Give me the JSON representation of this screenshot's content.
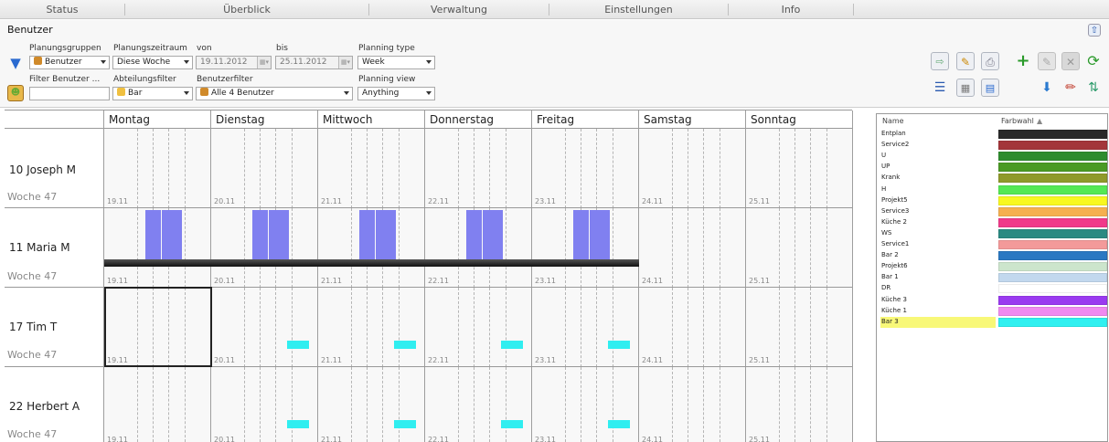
{
  "menu": [
    "Status",
    "Überblick",
    "Verwaltung",
    "Einstellungen",
    "Info"
  ],
  "section_title": "Benutzer",
  "filters": {
    "planungsgruppen_label": "Planungsgruppen",
    "planungsgruppen_value": "Benutzer",
    "planungszeitraum_label": "Planungszeitraum",
    "planungszeitraum_value": "Diese Woche",
    "von_label": "von",
    "von_value": "19.11.2012",
    "bis_label": "bis",
    "bis_value": "25.11.2012",
    "planning_type_label": "Planning type",
    "planning_type_value": "Week",
    "filter_benutzer_label": "Filter Benutzer ...",
    "filter_benutzer_value": "",
    "abteilungsfilter_label": "Abteilungsfilter",
    "abteilungsfilter_value": "Bar",
    "benutzerfilter_label": "Benutzerfilter",
    "benutzerfilter_value": "Alle 4 Benutzer",
    "planning_view_label": "Planning view",
    "planning_view_value": "Anything"
  },
  "days": [
    "Montag",
    "Dienstag",
    "Mittwoch",
    "Donnerstag",
    "Freitag",
    "Samstag",
    "Sonntag"
  ],
  "dates": [
    "19.11",
    "20.11",
    "21.11",
    "22.11",
    "23.11",
    "24.11",
    "25.11"
  ],
  "rows": [
    {
      "name": "10 Joseph M",
      "week": "Woche 47"
    },
    {
      "name": "11 Maria M",
      "week": "Woche 47"
    },
    {
      "name": "17 Tim T",
      "week": "Woche 47"
    },
    {
      "name": "22 Herbert A",
      "week": "Woche 47"
    }
  ],
  "legend": {
    "header_name": "Name",
    "header_color": "Farbwahl",
    "selected": "Bar 3",
    "items": [
      {
        "name": "Entplan",
        "color": "#2a2a2a"
      },
      {
        "name": "Service2",
        "color": "#a3363a"
      },
      {
        "name": "U",
        "color": "#2e8c2e"
      },
      {
        "name": "UP",
        "color": "#4a9a24"
      },
      {
        "name": "Krank",
        "color": "#8f9a2a"
      },
      {
        "name": "H",
        "color": "#54e854"
      },
      {
        "name": "Projekt5",
        "color": "#f8f820"
      },
      {
        "name": "Service3",
        "color": "#f5b050"
      },
      {
        "name": "Küche 2",
        "color": "#f03a8a"
      },
      {
        "name": "WS",
        "color": "#2a8a82"
      },
      {
        "name": "Service1",
        "color": "#f39a9a"
      },
      {
        "name": "Bar 2",
        "color": "#2a78c2"
      },
      {
        "name": "Projekt6",
        "color": "#cce5cc"
      },
      {
        "name": "Bar 1",
        "color": "#c2d8ee"
      },
      {
        "name": "DR",
        "color": "#ffffff"
      },
      {
        "name": "Küche 3",
        "color": "#9a3af0"
      },
      {
        "name": "Küche 1",
        "color": "#f08af0"
      },
      {
        "name": "Bar 3",
        "color": "#30f0f0"
      }
    ]
  },
  "colors": {
    "shift_blue": "#8080f0",
    "shift_cyan": "#30eef0",
    "selected_row": "#f8f878"
  },
  "toolbar_icons": [
    "import-icon",
    "edit-document-icon",
    "print-icon",
    "add-icon",
    "edit-icon",
    "delete-icon",
    "refresh-icon",
    "list-icon",
    "table-icon",
    "form-icon",
    "download-icon",
    "pencil-icon",
    "swap-icon",
    "filter-icon",
    "user-group-icon",
    "collapse-icon"
  ]
}
